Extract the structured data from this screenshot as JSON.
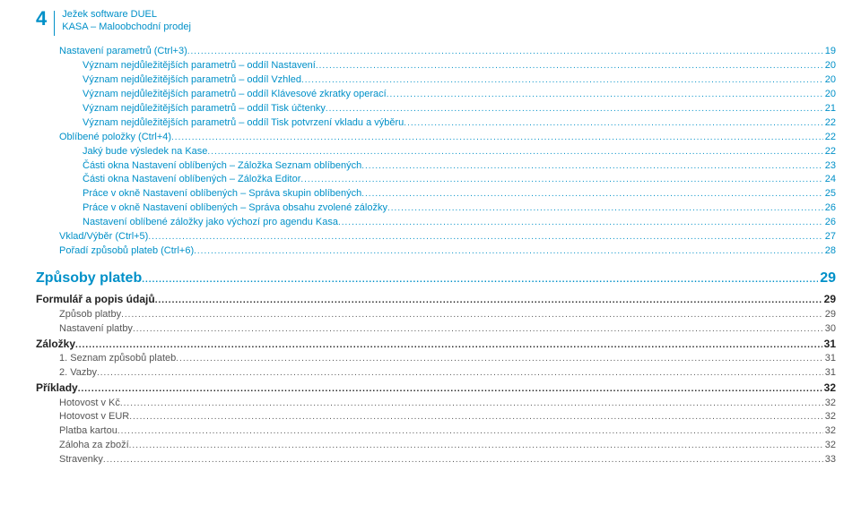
{
  "header": {
    "pageNumber": "4",
    "line1": "Ježek software DUEL",
    "line2": "KASA – Maloobchodní prodej"
  },
  "toc": [
    {
      "label": "Nastavení parametrů (Ctrl+3)",
      "page": "19",
      "indent": 1,
      "cls": "blue"
    },
    {
      "label": "Význam nejdůležitějších parametrů – oddíl Nastavení",
      "page": "20",
      "indent": 2,
      "cls": "blue"
    },
    {
      "label": "Význam nejdůležitějších parametrů – oddíl Vzhled",
      "page": "20",
      "indent": 2,
      "cls": "blue"
    },
    {
      "label": "Význam nejdůležitějších parametrů – oddíl Klávesové zkratky operací",
      "page": "20",
      "indent": 2,
      "cls": "blue"
    },
    {
      "label": "Význam nejdůležitějších parametrů – oddíl Tisk účtenky",
      "page": "21",
      "indent": 2,
      "cls": "blue"
    },
    {
      "label": "Význam nejdůležitějších parametrů – oddíl Tisk potvrzení vkladu a výběru",
      "page": "22",
      "indent": 2,
      "cls": "blue"
    },
    {
      "label": "Oblíbené položky (Ctrl+4)",
      "page": "22",
      "indent": 1,
      "cls": "blue"
    },
    {
      "label": "Jaký bude výsledek na Kase",
      "page": "22",
      "indent": 2,
      "cls": "blue"
    },
    {
      "label": "Části okna Nastavení oblíbených – Záložka Seznam oblíbených",
      "page": "23",
      "indent": 2,
      "cls": "blue"
    },
    {
      "label": "Části okna Nastavení oblíbených – Záložka Editor",
      "page": "24",
      "indent": 2,
      "cls": "blue"
    },
    {
      "label": "Práce v okně Nastavení oblíbených – Správa skupin oblíbených",
      "page": "25",
      "indent": 2,
      "cls": "blue"
    },
    {
      "label": "Práce v okně Nastavení oblíbených – Správa obsahu zvolené záložky",
      "page": "26",
      "indent": 2,
      "cls": "blue"
    },
    {
      "label": "Nastavení oblíbené záložky jako výchozí pro agendu Kasa",
      "page": "26",
      "indent": 2,
      "cls": "blue"
    },
    {
      "label": "Vklad/Výběr (Ctrl+5)",
      "page": "27",
      "indent": 1,
      "cls": "blue"
    },
    {
      "label": "Pořadí způsobů plateb (Ctrl+6)",
      "page": "28",
      "indent": 1,
      "cls": "blue"
    },
    {
      "label": "Způsoby plateb",
      "page": "29",
      "indent": 0,
      "cls": "chapter"
    },
    {
      "label": "Formulář a popis údajů",
      "page": "29",
      "indent": 0,
      "cls": "sec1"
    },
    {
      "label": "Způsob platby",
      "page": "29",
      "indent": 1,
      "cls": "grey"
    },
    {
      "label": "Nastavení platby",
      "page": "30",
      "indent": 1,
      "cls": "grey"
    },
    {
      "label": "Záložky",
      "page": "31",
      "indent": 0,
      "cls": "sec1"
    },
    {
      "label": "1. Seznam způsobů plateb",
      "page": "31",
      "indent": 1,
      "cls": "grey"
    },
    {
      "label": "2. Vazby",
      "page": "31",
      "indent": 1,
      "cls": "grey"
    },
    {
      "label": "Příklady",
      "page": "32",
      "indent": 0,
      "cls": "sec1"
    },
    {
      "label": "Hotovost v Kč",
      "page": "32",
      "indent": 1,
      "cls": "grey"
    },
    {
      "label": "Hotovost v EUR",
      "page": "32",
      "indent": 1,
      "cls": "grey"
    },
    {
      "label": "Platba kartou",
      "page": "32",
      "indent": 1,
      "cls": "grey"
    },
    {
      "label": "Záloha za zboží",
      "page": "32",
      "indent": 1,
      "cls": "grey"
    },
    {
      "label": "Stravenky",
      "page": "33",
      "indent": 1,
      "cls": "grey"
    }
  ]
}
